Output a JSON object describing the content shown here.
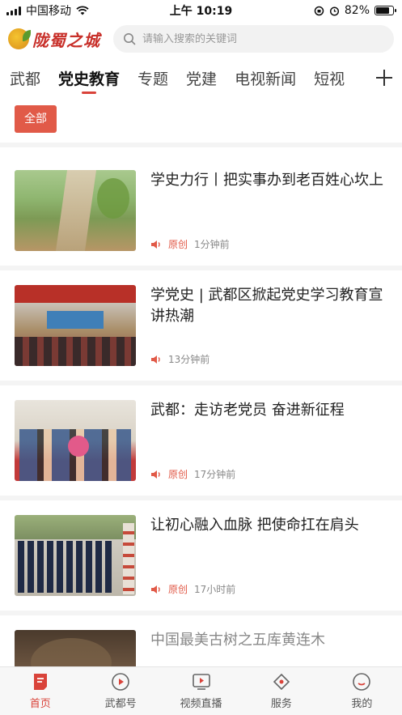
{
  "status_bar": {
    "carrier": "中国移动",
    "time": "上午 10:19",
    "battery_percent": "82%",
    "battery_level": 0.82
  },
  "header": {
    "logo_text": "陇蜀之城",
    "search_placeholder": "请输入搜索的关键词"
  },
  "tabs": [
    {
      "label": "武都",
      "active": false
    },
    {
      "label": "党史教育",
      "active": true
    },
    {
      "label": "专题",
      "active": false
    },
    {
      "label": "党建",
      "active": false
    },
    {
      "label": "电视新闻",
      "active": false
    },
    {
      "label": "短视",
      "active": false
    }
  ],
  "filter": {
    "label": "全部"
  },
  "news": [
    {
      "title": "学史力行丨把实事办到老百姓心坎上",
      "tag": "原创",
      "time": "1分钟前",
      "faded": false
    },
    {
      "title": "学党史 | 武都区掀起党史学习教育宣讲热潮",
      "tag": "",
      "time": "13分钟前",
      "faded": false
    },
    {
      "title": "武都：走访老党员 奋进新征程",
      "tag": "原创",
      "time": "17分钟前",
      "faded": false
    },
    {
      "title": "让初心融入血脉 把使命扛在肩头",
      "tag": "原创",
      "time": "17小时前",
      "faded": false
    },
    {
      "title": "中国最美古树之五库黄连木",
      "tag": "",
      "time": "",
      "faded": true
    }
  ],
  "bottom_nav": [
    {
      "label": "首页",
      "icon": "home-doc-icon",
      "active": true
    },
    {
      "label": "武都号",
      "icon": "play-circle-icon",
      "active": false
    },
    {
      "label": "视频直播",
      "icon": "tv-play-icon",
      "active": false
    },
    {
      "label": "服务",
      "icon": "diamond-service-icon",
      "active": false
    },
    {
      "label": "我的",
      "icon": "user-face-icon",
      "active": false
    }
  ],
  "colors": {
    "accent": "#d9433a",
    "chip": "#e15a48",
    "divider": "#f4f4f4"
  }
}
